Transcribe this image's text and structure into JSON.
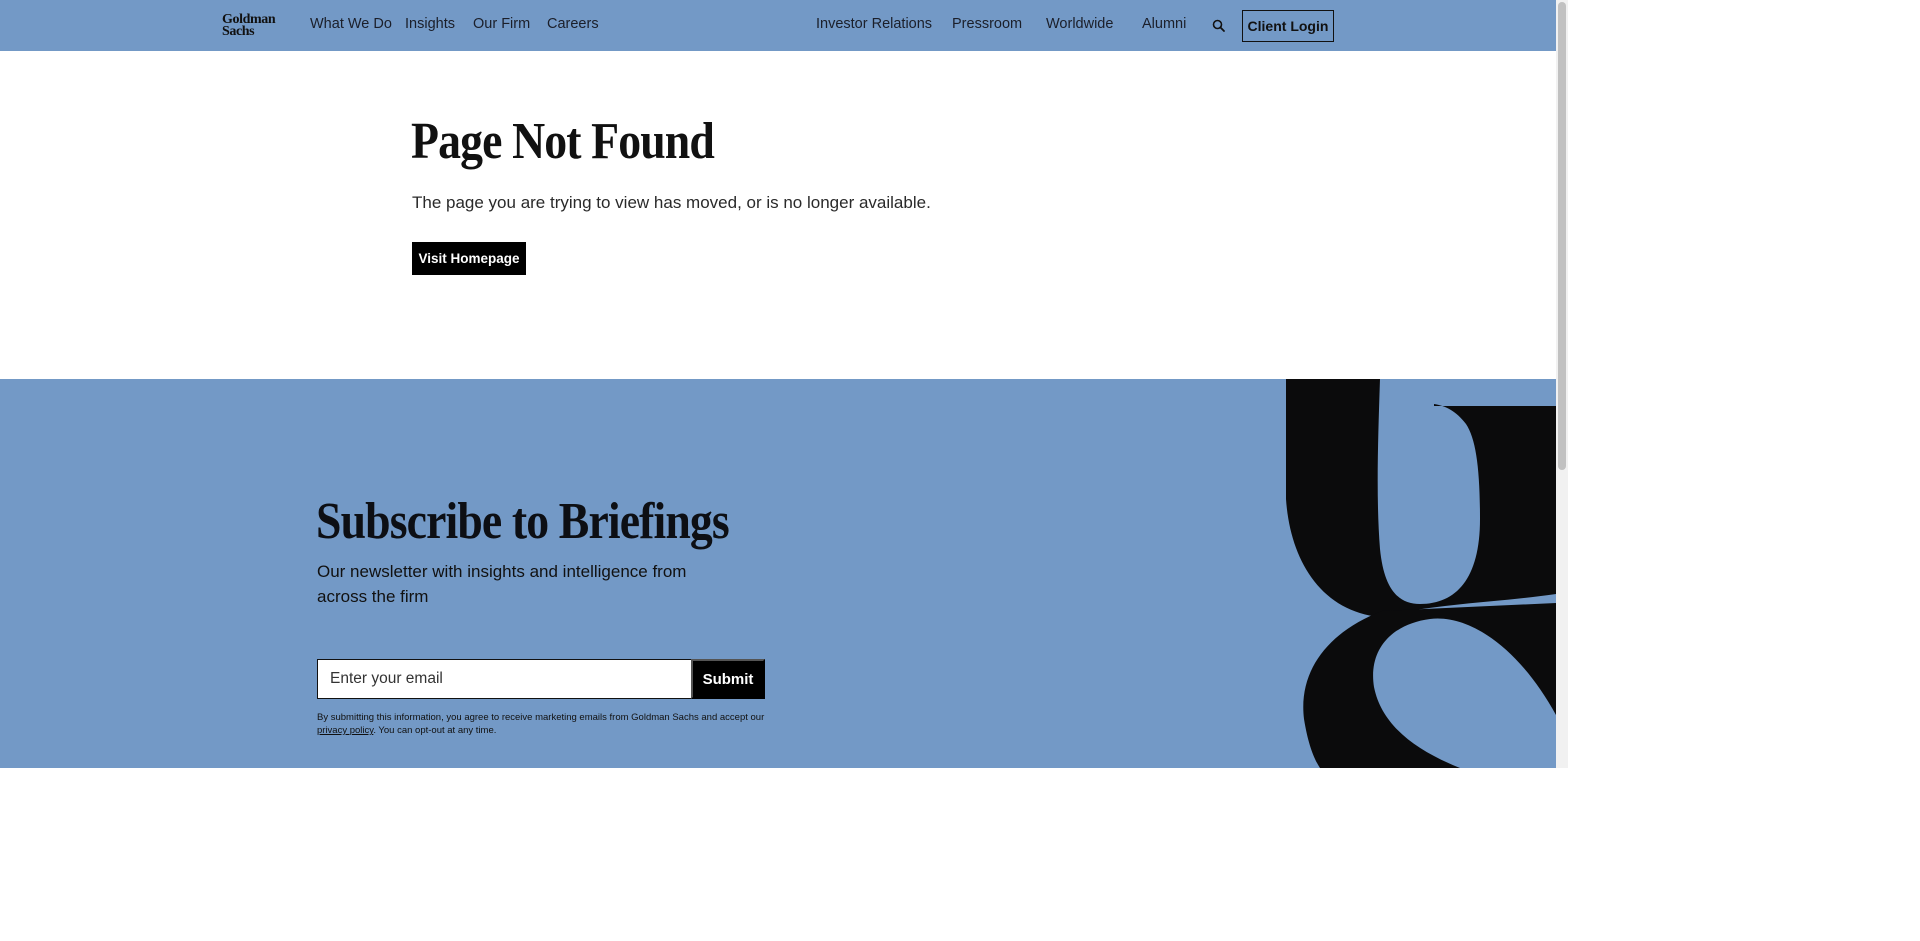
{
  "header": {
    "logo_line1": "Goldman",
    "logo_line2": "Sachs",
    "nav_left": [
      "What We Do",
      "Insights",
      "Our Firm",
      "Careers"
    ],
    "nav_right": [
      "Investor Relations",
      "Pressroom",
      "Worldwide",
      "Alumni"
    ],
    "search_icon": "search-icon",
    "client_login_label": "Client Login"
  },
  "not_found": {
    "title": "Page Not Found",
    "message": "The page you are trying to view has moved, or is no longer available.",
    "button_label": "Visit Homepage"
  },
  "subscribe": {
    "title": "Subscribe to Briefings",
    "description": "Our newsletter with insights and intelligence from across the firm",
    "email_placeholder": "Enter your email",
    "submit_label": "Submit",
    "disclaimer_before": "By submitting this information, you agree to receive marketing emails from Goldman Sachs and accept our ",
    "privacy_link": "privacy policy",
    "disclaimer_after": ". You can opt-out at any time."
  },
  "colors": {
    "brand_blue": "#7399c6",
    "black": "#000000",
    "white": "#ffffff"
  }
}
